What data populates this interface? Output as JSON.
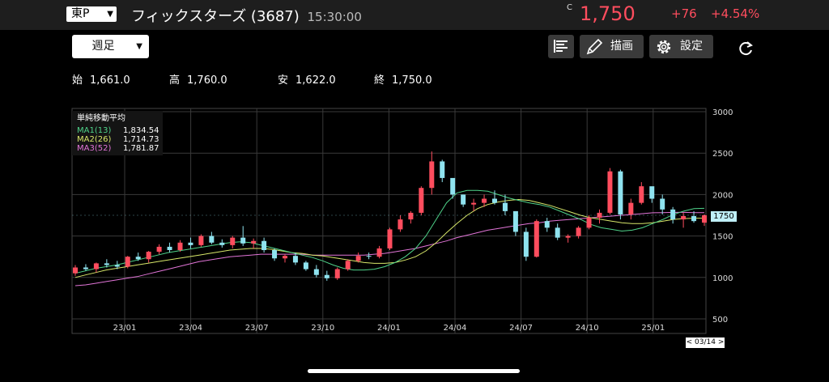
{
  "header": {
    "exchange": "東P",
    "stock_name": "フィックスターズ (3687)",
    "time": "15:30:00",
    "close_mark": "C",
    "price": "1,750",
    "change": "+76",
    "change_pct": "+4.54%"
  },
  "toolbar": {
    "period_label": "週足",
    "draw_label": "描画",
    "settings_label": "設定"
  },
  "ohlc": {
    "open_label": "始",
    "open": "1,661.0",
    "high_label": "高",
    "high": "1,760.0",
    "low_label": "安",
    "low": "1,622.0",
    "close_label": "終",
    "close": "1,750.0"
  },
  "legend": {
    "title": "単純移動平均",
    "ma1_label": "MA1(13)",
    "ma1_value": "1,834.54",
    "ma2_label": "MA2(26)",
    "ma2_value": "1,714.73",
    "ma3_label": "MA3(52)",
    "ma3_value": "1,781.87"
  },
  "colors": {
    "up": "#ff4d5e",
    "down": "#8fe3ef",
    "ma1": "#4fd38a",
    "ma2": "#d8e86a",
    "ma3": "#e275d8"
  },
  "chart_data": {
    "type": "candlestick",
    "y_ticks": [
      "3000",
      "2500",
      "2000",
      "1500",
      "1000",
      "500"
    ],
    "ylim": [
      500,
      3000
    ],
    "x_labels": [
      "23/01",
      "23/04",
      "23/07",
      "23/10",
      "24/01",
      "24/04",
      "24/07",
      "24/10",
      "25/01"
    ],
    "last_price_label": "1750",
    "date_label": "< 03/14 >",
    "ma1": [
      1050,
      1080,
      1110,
      1130,
      1150,
      1180,
      1210,
      1240,
      1270,
      1300,
      1320,
      1340,
      1360,
      1380,
      1400,
      1420,
      1430,
      1420,
      1390,
      1360,
      1330,
      1300,
      1270,
      1240,
      1200,
      1150,
      1110,
      1090,
      1090,
      1100,
      1130,
      1180,
      1250,
      1350,
      1500,
      1700,
      1900,
      2020,
      2050,
      2050,
      2040,
      2000,
      1960,
      1930,
      1900,
      1880,
      1850,
      1800,
      1750,
      1700,
      1640,
      1600,
      1580,
      1560,
      1570,
      1600,
      1650,
      1700,
      1760,
      1800,
      1830,
      1834
    ],
    "ma2": [
      1000,
      1030,
      1060,
      1090,
      1110,
      1130,
      1150,
      1170,
      1190,
      1210,
      1230,
      1250,
      1270,
      1290,
      1310,
      1330,
      1340,
      1350,
      1350,
      1340,
      1320,
      1300,
      1290,
      1270,
      1260,
      1240,
      1220,
      1200,
      1180,
      1170,
      1170,
      1180,
      1210,
      1250,
      1320,
      1420,
      1540,
      1650,
      1750,
      1830,
      1880,
      1910,
      1930,
      1940,
      1930,
      1900,
      1870,
      1830,
      1790,
      1750,
      1720,
      1700,
      1680,
      1660,
      1650,
      1650,
      1660,
      1680,
      1700,
      1710,
      1715,
      1715
    ],
    "ma3": [
      900,
      910,
      930,
      950,
      970,
      990,
      1010,
      1040,
      1070,
      1100,
      1130,
      1160,
      1190,
      1210,
      1230,
      1250,
      1260,
      1270,
      1280,
      1280,
      1280,
      1280,
      1280,
      1270,
      1270,
      1270,
      1270,
      1270,
      1270,
      1280,
      1290,
      1310,
      1330,
      1350,
      1380,
      1410,
      1440,
      1480,
      1510,
      1540,
      1570,
      1590,
      1610,
      1630,
      1650,
      1660,
      1680,
      1690,
      1700,
      1710,
      1720,
      1730,
      1740,
      1750,
      1760,
      1770,
      1780,
      1782,
      1785,
      1785,
      1782,
      1782
    ],
    "candles": [
      [
        1050,
        1150,
        1020,
        1120
      ],
      [
        1120,
        1160,
        1080,
        1100
      ],
      [
        1100,
        1180,
        1060,
        1170
      ],
      [
        1170,
        1220,
        1120,
        1150
      ],
      [
        1150,
        1200,
        1100,
        1130
      ],
      [
        1130,
        1260,
        1110,
        1250
      ],
      [
        1250,
        1300,
        1200,
        1220
      ],
      [
        1220,
        1320,
        1180,
        1310
      ],
      [
        1310,
        1400,
        1280,
        1370
      ],
      [
        1370,
        1420,
        1300,
        1330
      ],
      [
        1330,
        1450,
        1310,
        1420
      ],
      [
        1420,
        1480,
        1350,
        1390
      ],
      [
        1390,
        1520,
        1370,
        1500
      ],
      [
        1500,
        1550,
        1400,
        1420
      ],
      [
        1420,
        1460,
        1360,
        1390
      ],
      [
        1390,
        1500,
        1350,
        1480
      ],
      [
        1480,
        1620,
        1380,
        1410
      ],
      [
        1410,
        1470,
        1350,
        1440
      ],
      [
        1440,
        1480,
        1300,
        1330
      ],
      [
        1330,
        1350,
        1200,
        1230
      ],
      [
        1230,
        1280,
        1180,
        1260
      ],
      [
        1260,
        1300,
        1150,
        1180
      ],
      [
        1180,
        1200,
        1080,
        1100
      ],
      [
        1100,
        1150,
        1000,
        1030
      ],
      [
        1030,
        1080,
        960,
        990
      ],
      [
        990,
        1120,
        970,
        1100
      ],
      [
        1100,
        1220,
        1080,
        1200
      ],
      [
        1200,
        1300,
        1180,
        1260
      ],
      [
        1260,
        1300,
        1220,
        1250
      ],
      [
        1250,
        1380,
        1230,
        1350
      ],
      [
        1350,
        1600,
        1330,
        1580
      ],
      [
        1580,
        1750,
        1550,
        1700
      ],
      [
        1700,
        1800,
        1650,
        1780
      ],
      [
        1780,
        2100,
        1750,
        2080
      ],
      [
        2080,
        2520,
        2000,
        2400
      ],
      [
        2400,
        2420,
        2150,
        2200
      ],
      [
        2200,
        2150,
        1950,
        2000
      ],
      [
        2000,
        2000,
        1850,
        1880
      ],
      [
        1880,
        1950,
        1800,
        1900
      ],
      [
        1900,
        2000,
        1850,
        1950
      ],
      [
        1950,
        2050,
        1880,
        1900
      ],
      [
        1900,
        2000,
        1750,
        1800
      ],
      [
        1800,
        1750,
        1500,
        1550
      ],
      [
        1550,
        1600,
        1200,
        1250
      ],
      [
        1250,
        1700,
        1240,
        1680
      ],
      [
        1680,
        1720,
        1550,
        1600
      ],
      [
        1600,
        1650,
        1450,
        1480
      ],
      [
        1480,
        1520,
        1420,
        1500
      ],
      [
        1500,
        1620,
        1470,
        1600
      ],
      [
        1600,
        1750,
        1580,
        1720
      ],
      [
        1720,
        1820,
        1650,
        1780
      ],
      [
        1780,
        2320,
        1760,
        2280
      ],
      [
        2280,
        2300,
        1700,
        1760
      ],
      [
        1760,
        1950,
        1700,
        1900
      ],
      [
        1900,
        2150,
        1880,
        2100
      ],
      [
        2100,
        2060,
        1900,
        1950
      ],
      [
        1950,
        2000,
        1760,
        1820
      ],
      [
        1820,
        1850,
        1650,
        1700
      ],
      [
        1700,
        1780,
        1600,
        1740
      ],
      [
        1740,
        1800,
        1660,
        1680
      ],
      [
        1661,
        1760,
        1622,
        1750
      ]
    ]
  }
}
